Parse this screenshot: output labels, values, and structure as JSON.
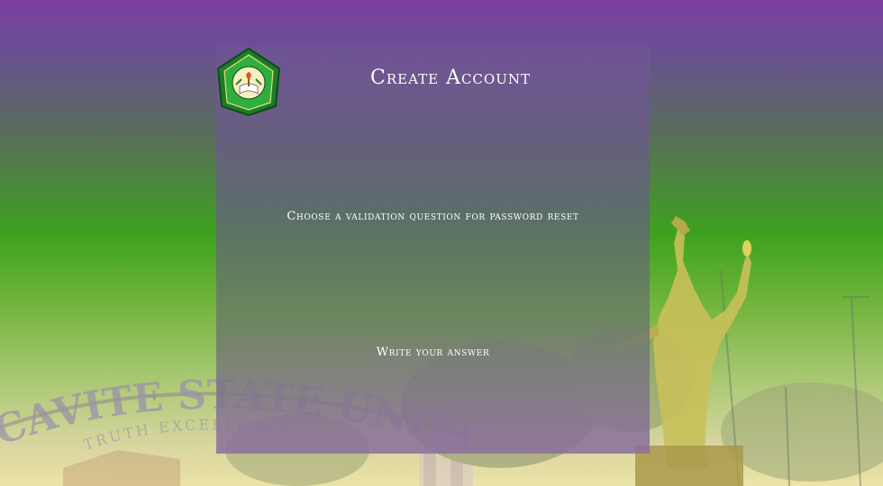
{
  "header": {
    "title": "Create Account"
  },
  "logo": {
    "name": "university-seal"
  },
  "form": {
    "question_label": "Choose a validation question for password reset",
    "answer_placeholder": "Write your answer",
    "answer_value": ""
  },
  "background": {
    "arch_text_main": "CAVITE STATE UNIVERSITY",
    "arch_text_sub": "TRUTH EXCELLENCE"
  },
  "colors": {
    "top": "#7a3fa3",
    "green": "#3ea11f",
    "bottom": "#ece3a6",
    "card": "#705496"
  }
}
